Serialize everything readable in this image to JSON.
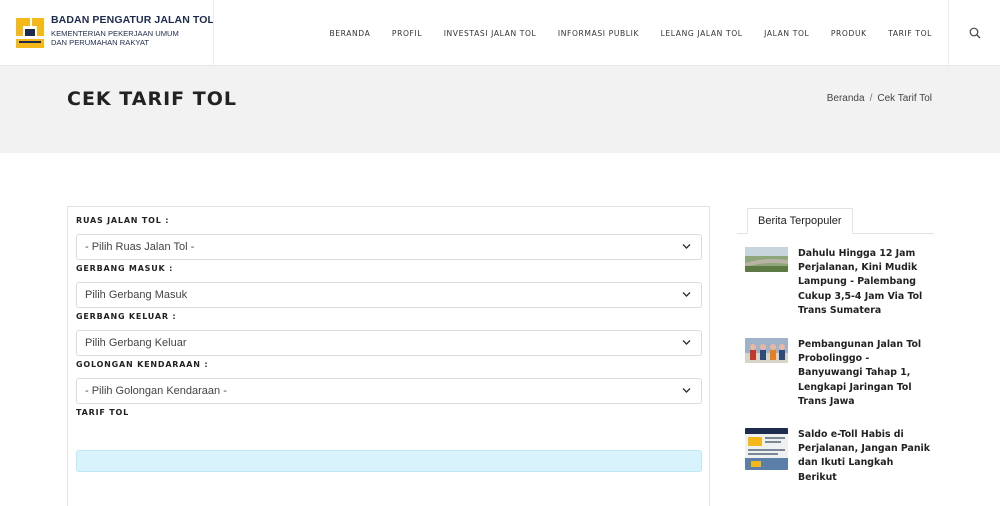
{
  "header": {
    "logo_title": "BADAN PENGATUR JALAN TOL",
    "logo_sub_1": "KEMENTERIAN PEKERJAAN UMUM",
    "logo_sub_2": "DAN PERUMAHAN RAKYAT",
    "nav": [
      "BERANDA",
      "PROFIL",
      "INVESTASI JALAN TOL",
      "INFORMASI PUBLIK",
      "LELANG JALAN TOL",
      "JALAN TOL",
      "PRODUK",
      "TARIF TOL"
    ],
    "search_icon": "search-icon",
    "brand_colors": {
      "yellow": "#f5b81a",
      "navy": "#1d2b4f"
    }
  },
  "page": {
    "title": "CEK TARIF TOL",
    "breadcrumb": [
      "Beranda",
      "Cek Tarif Tol"
    ]
  },
  "form": {
    "ruas_label": "RUAS JALAN TOL :",
    "ruas_value": "- Pilih Ruas Jalan Tol -",
    "masuk_label": "GERBANG MASUK :",
    "masuk_value": "Pilih Gerbang Masuk",
    "keluar_label": "GERBANG KELUAR :",
    "keluar_value": "Pilih Gerbang Keluar",
    "golongan_label": "GOLONGAN KENDARAAN :",
    "golongan_value": "- Pilih Golongan Kendaraan -",
    "tarif_label": "TARIF TOL",
    "tarif_value": "",
    "result_color": "#d9f3fd"
  },
  "sidebar": {
    "tab": "Berita Terpopuler",
    "news": [
      {
        "title": "Dahulu Hingga 12 Jam Perjalanan, Kini Mudik Lampung - Palembang Cukup 3,5-4 Jam Via Tol Trans Sumatera"
      },
      {
        "title": "Pembangunan Jalan Tol Probolinggo - Banyuwangi Tahap 1, Lengkapi Jaringan Tol Trans Jawa"
      },
      {
        "title": "Saldo e-Toll Habis di Perjalanan, Jangan Panik dan Ikuti Langkah Berikut"
      }
    ]
  }
}
